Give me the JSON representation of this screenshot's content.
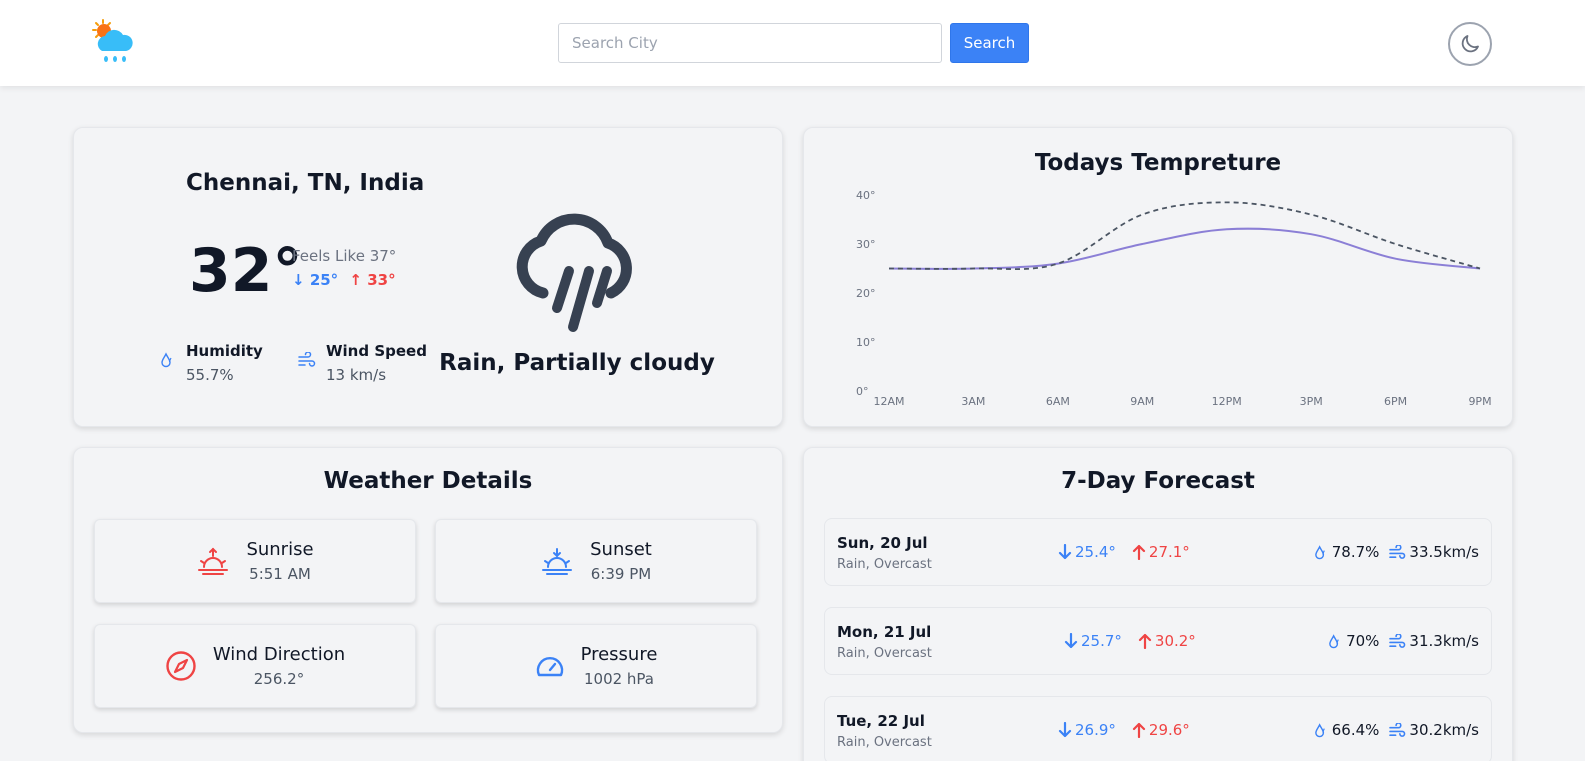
{
  "header": {
    "search_placeholder": "Search City",
    "search_label": "Search"
  },
  "current": {
    "city": "Chennai, TN, India",
    "temp": "32°",
    "feels_like": "Feels Like 37°",
    "min": "25°",
    "max": "33°",
    "humidity_label": "Humidity",
    "humidity_value": "55.7%",
    "wind_label": "Wind Speed",
    "wind_value": "13 km/s",
    "condition": "Rain, Partially cloudy"
  },
  "chart": {
    "title": "Todays Tempreture"
  },
  "chart_data": {
    "type": "line",
    "categories": [
      "12AM",
      "3AM",
      "6AM",
      "9AM",
      "12PM",
      "3PM",
      "6PM",
      "9PM"
    ],
    "series": [
      {
        "values": [
          25,
          25,
          26,
          30,
          33,
          32,
          27,
          25
        ],
        "color": "#8b7fd6",
        "style": "solid"
      },
      {
        "values": [
          25,
          25,
          26,
          36,
          38.5,
          36,
          30,
          25
        ],
        "color": "#4b5563",
        "style": "dashed"
      }
    ],
    "yticks": [
      "0°",
      "10°",
      "20°",
      "30°",
      "40°"
    ],
    "ylim": [
      0,
      40
    ],
    "grid": false
  },
  "details": {
    "title": "Weather Details",
    "items": [
      {
        "label": "Sunrise",
        "value": "5:51 AM"
      },
      {
        "label": "Sunset",
        "value": "6:39 PM"
      },
      {
        "label": "Wind Direction",
        "value": "256.2°"
      },
      {
        "label": "Pressure",
        "value": "1002 hPa"
      }
    ]
  },
  "forecast": {
    "title": "7-Day Forecast",
    "days": [
      {
        "date": "Sun, 20 Jul",
        "desc": "Rain, Overcast",
        "min": "25.4°",
        "max": "27.1°",
        "humidity": "78.7%",
        "wind": "33.5km/s"
      },
      {
        "date": "Mon, 21 Jul",
        "desc": "Rain, Overcast",
        "min": "25.7°",
        "max": "30.2°",
        "humidity": "70%",
        "wind": "31.3km/s"
      },
      {
        "date": "Tue, 22 Jul",
        "desc": "Rain, Overcast",
        "min": "26.9°",
        "max": "29.6°",
        "humidity": "66.4%",
        "wind": "30.2km/s"
      }
    ]
  },
  "colors": {
    "accent": "#3b82f6",
    "high": "#ef4444",
    "background": "#f3f4f6"
  }
}
